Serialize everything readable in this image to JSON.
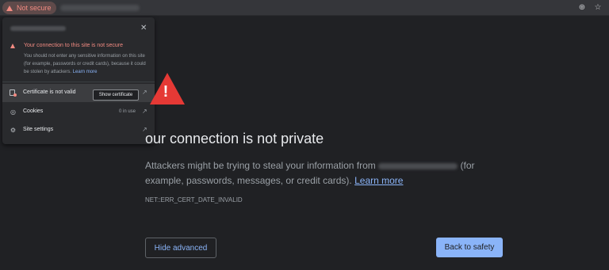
{
  "toolbar": {
    "security_chip_label": "Not secure",
    "warning_icon": "warning-triangle-icon",
    "zoom_icon": "zoom-icon",
    "bookmark_icon": "star-icon"
  },
  "popup": {
    "close_icon": "close-icon",
    "warning_title": "Your connection to this site is not secure",
    "warning_description": "You should not enter any sensitive information on this site (for example, passwords or credit cards), because it could be stolen by attackers.",
    "learn_more": "Learn more",
    "rows": [
      {
        "icon": "certificate-icon",
        "label": "Certificate is not valid",
        "meta": ""
      },
      {
        "icon": "cookie-icon",
        "label": "Cookies",
        "meta": "0 in use"
      },
      {
        "icon": "gear-icon",
        "label": "Site settings",
        "meta": ""
      }
    ],
    "tooltip": "Show certificate",
    "external_link_icon": "external-link-icon"
  },
  "main": {
    "warning_icon": "warning-triangle-icon",
    "heading": "our connection is not private",
    "body_prefix": "Attackers might be trying to steal your information from",
    "body_suffix": "(for example, passwords, messages, or credit cards).",
    "body_link": "Learn more",
    "error_code": "NET::ERR_CERT_DATE_INVALID",
    "hide_advanced": "Hide advanced",
    "back_to_safety": "Back to safety"
  },
  "colors": {
    "background": "#202124",
    "warning_red": "#f28b82",
    "big_warning_red": "#e53935",
    "link_blue": "#8ab4f8"
  }
}
